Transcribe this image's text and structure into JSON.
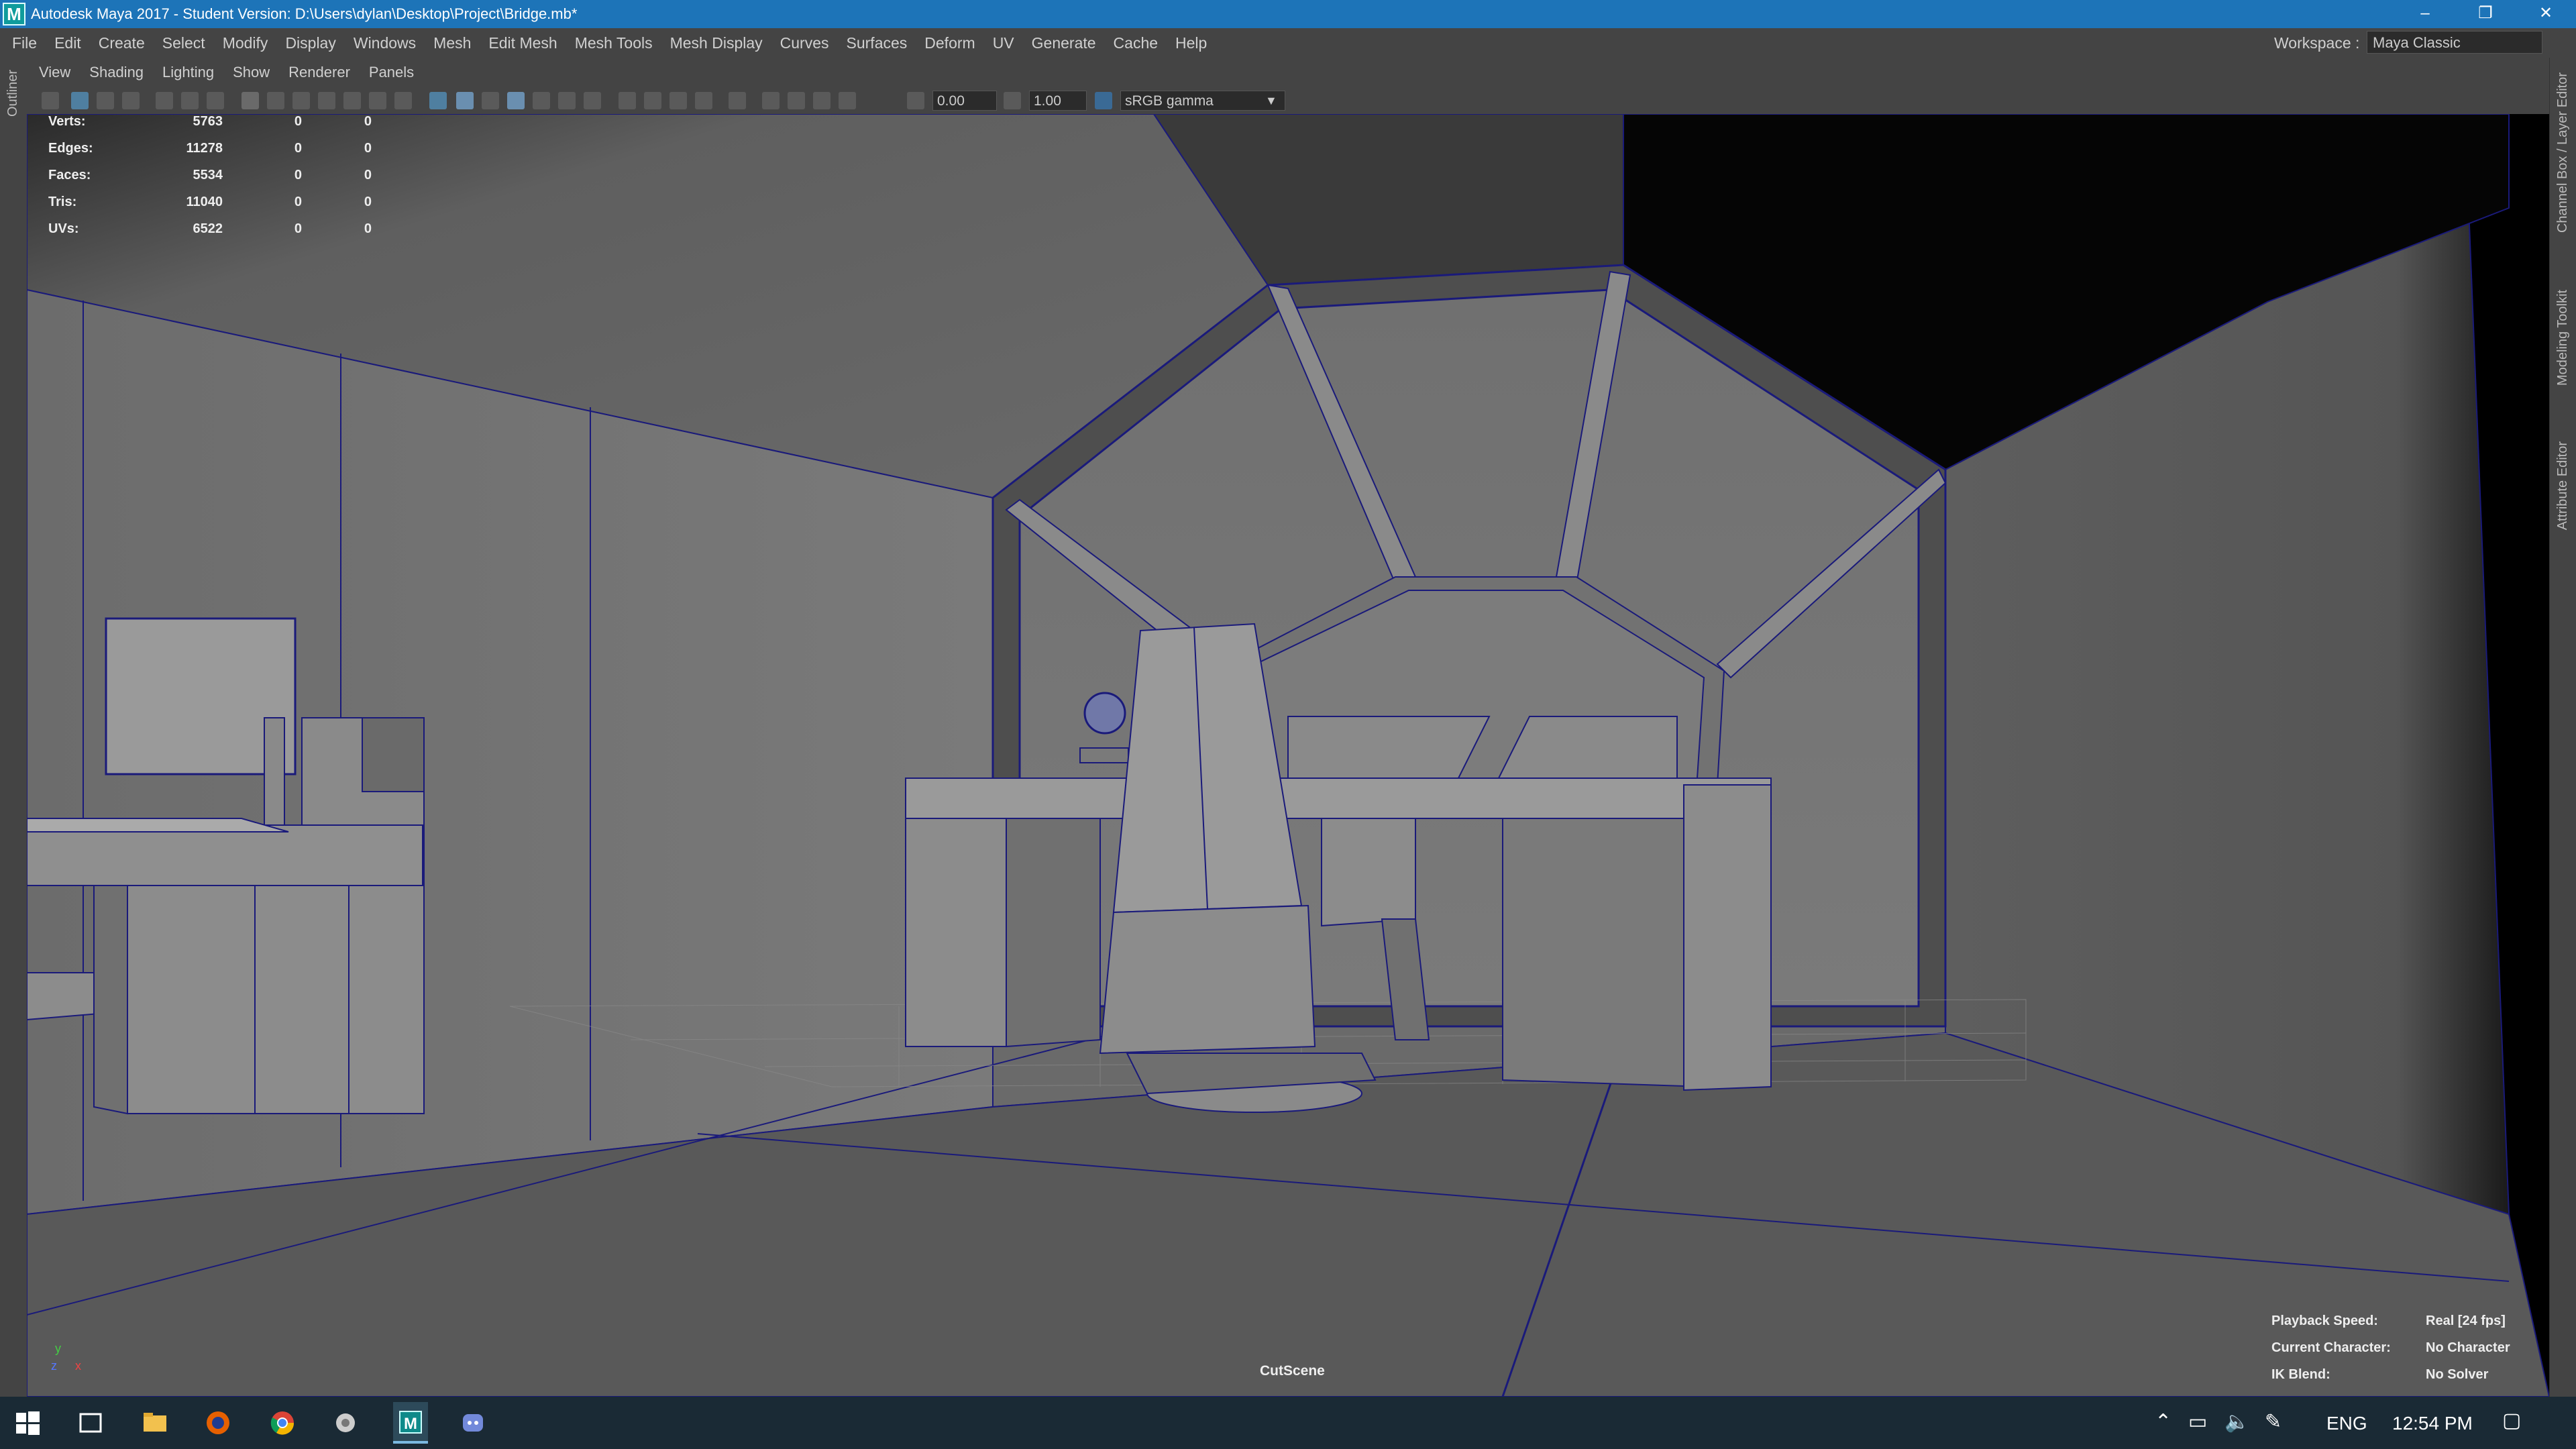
{
  "window": {
    "title": "Autodesk Maya 2017 - Student Version: D:\\Users\\dylan\\Desktop\\Project\\Bridge.mb*",
    "logo_letter": "M",
    "minimize": "–",
    "restore": "❐",
    "close": "✕"
  },
  "menubar": {
    "items": [
      "File",
      "Edit",
      "Create",
      "Select",
      "Modify",
      "Display",
      "Windows",
      "Mesh",
      "Edit Mesh",
      "Mesh Tools",
      "Mesh Display",
      "Curves",
      "Surfaces",
      "Deform",
      "UV",
      "Generate",
      "Cache",
      "Help"
    ],
    "workspace_label": "Workspace :",
    "workspace_value": "Maya Classic"
  },
  "left_panel": {
    "label": "Outliner"
  },
  "right_panel": {
    "labels": [
      "Channel Box / Layer Editor",
      "Modeling Toolkit",
      "Attribute Editor"
    ]
  },
  "panel_menu": {
    "items": [
      "View",
      "Shading",
      "Lighting",
      "Show",
      "Renderer",
      "Panels"
    ]
  },
  "toolbar": {
    "exposure": "0.00",
    "gamma": "1.00",
    "colorspace": "sRGB gamma"
  },
  "hud": {
    "rows": [
      {
        "label": "Verts:",
        "v1": "5763",
        "v2": "0",
        "v3": "0"
      },
      {
        "label": "Edges:",
        "v1": "11278",
        "v2": "0",
        "v3": "0"
      },
      {
        "label": "Faces:",
        "v1": "5534",
        "v2": "0",
        "v3": "0"
      },
      {
        "label": "Tris:",
        "v1": "11040",
        "v2": "0",
        "v3": "0"
      },
      {
        "label": "UVs:",
        "v1": "6522",
        "v2": "0",
        "v3": "0"
      }
    ],
    "camera_name": "CutScene",
    "playback_speed_label": "Playback Speed:",
    "playback_speed_value": "Real [24 fps]",
    "current_character_label": "Current Character:",
    "current_character_value": "No Character",
    "ik_blend_label": "IK Blend:",
    "ik_blend_value": "No Solver",
    "axis_y": "y",
    "axis_z": "z",
    "axis_x": "x"
  },
  "colors": {
    "titlebar": "#1d74b8",
    "wireframe": "#1a1a7a",
    "panel_bg": "#444444",
    "taskbar": "#1a2a35"
  },
  "taskbar": {
    "icons": [
      "windows-start-icon",
      "task-view-icon",
      "file-explorer-icon",
      "firefox-icon",
      "chrome-icon",
      "app-icon",
      "maya-icon",
      "discord-icon"
    ],
    "lang": "ENG",
    "time": "12:54 PM"
  }
}
